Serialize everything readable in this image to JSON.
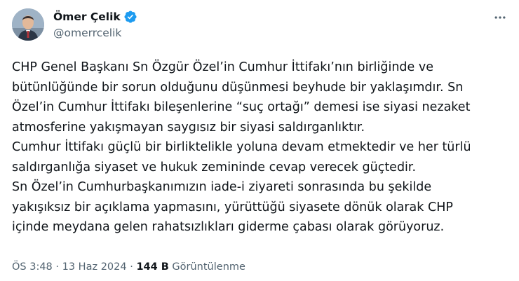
{
  "author": {
    "name": "Ömer Çelik",
    "handle": "@omerrcelik",
    "verified_color": "#1d9bf0"
  },
  "icons": {
    "verified": "verified-badge-icon",
    "more": "more-horizontal-icon"
  },
  "tweet": {
    "lines": [
      "CHP Genel Başkanı Sn Özgür Özel’in Cumhur İttifakı’nın birliğinde ve",
      "bütünlüğünde bir sorun olduğunu düşünmesi beyhude bir yaklaşımdır. Sn",
      "Özel’in Cumhur İttifakı bileşenlerine “suç ortağı” demesi ise siyasi nezaket",
      "atmosferine yakışmayan saygısız bir siyasi saldırganlıktır.",
      "Cumhur İttifakı güçlü bir birliktelikle yoluna devam etmektedir ve her türlü",
      "saldırganlığa siyaset ve hukuk zemininde cevap verecek güçtedir.",
      "Sn Özel’in Cumhurbaşkanımızın iade-i ziyareti sonrasında bu şekilde",
      "yakışıksız bir açıklama yapmasını, yürüttüğü siyasete dönük olarak CHP",
      "içinde meydana gelen rahatsızlıkları giderme çabası olarak görüyoruz."
    ]
  },
  "meta": {
    "time": "ÖS 3:48",
    "separator": "·",
    "date": "13 Haz 2024",
    "views_count": "144 B",
    "views_label": "Görüntülenme"
  }
}
